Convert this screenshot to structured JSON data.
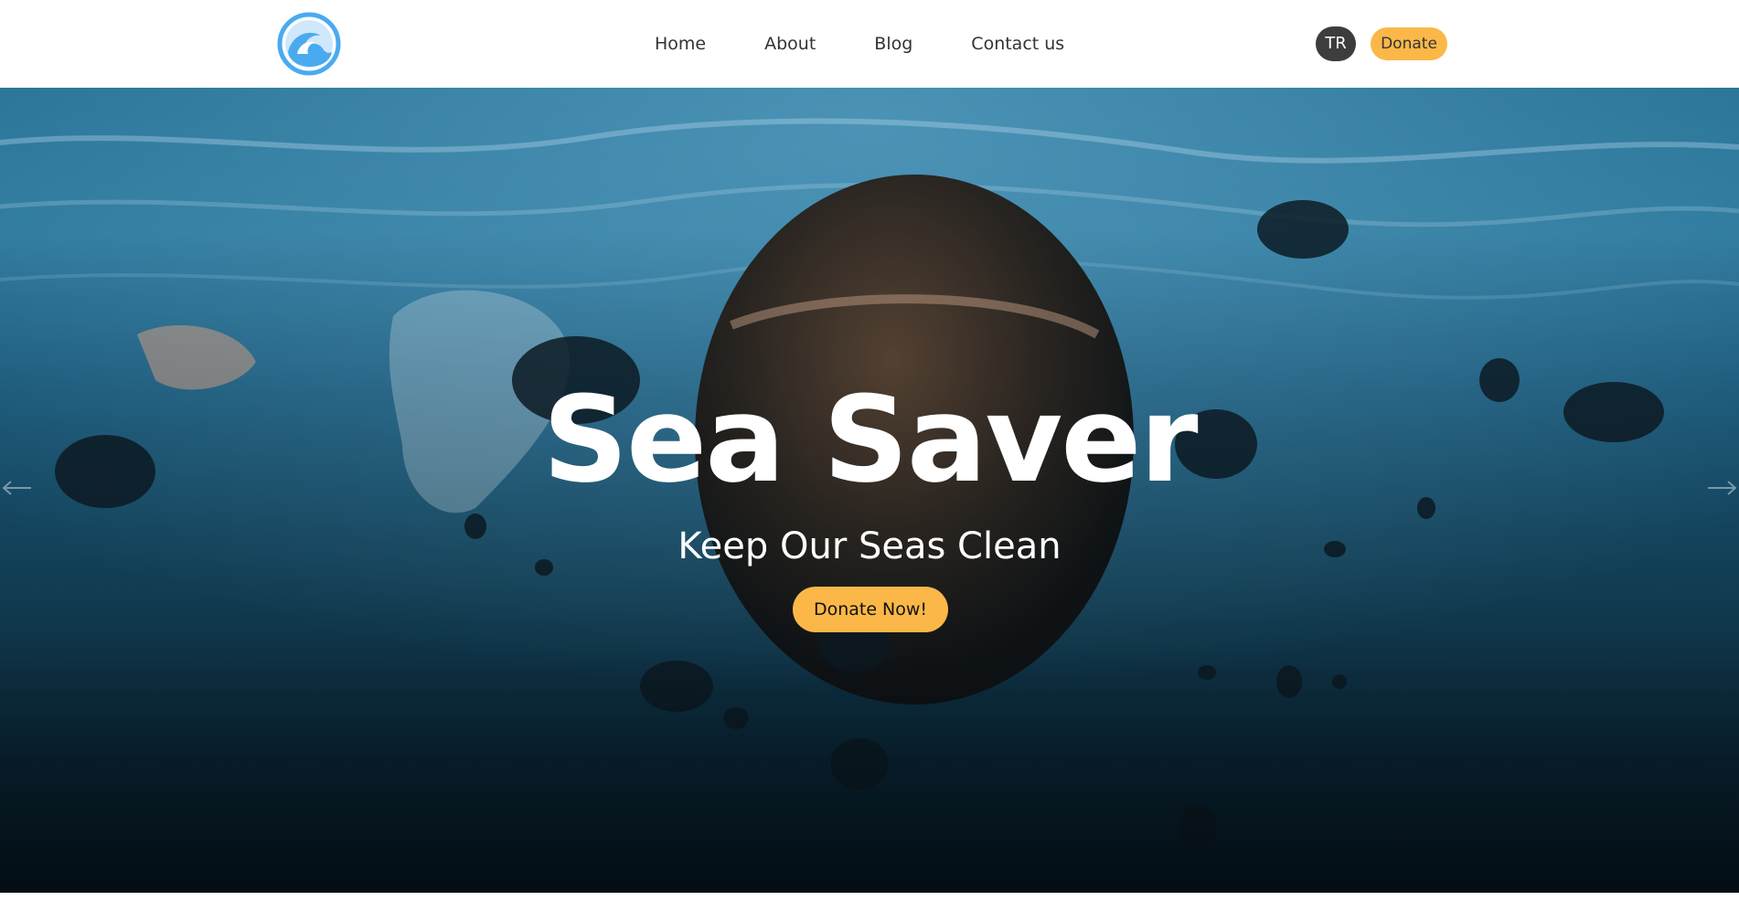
{
  "header": {
    "logo_icon": "wave-logo-icon",
    "nav": [
      {
        "label": "Home"
      },
      {
        "label": "About"
      },
      {
        "label": "Blog"
      },
      {
        "label": "Contact us"
      }
    ],
    "language_label": "TR",
    "donate_label": "Donate"
  },
  "hero": {
    "title": "Sea Saver",
    "subtitle": "Keep Our Seas Clean",
    "cta_label": "Donate Now!",
    "prev_icon": "arrow-left-icon",
    "next_icon": "arrow-right-icon"
  },
  "colors": {
    "accent": "#fbb848",
    "logo_blue": "#4aaaf0",
    "dark_button": "#3d3d3d"
  }
}
